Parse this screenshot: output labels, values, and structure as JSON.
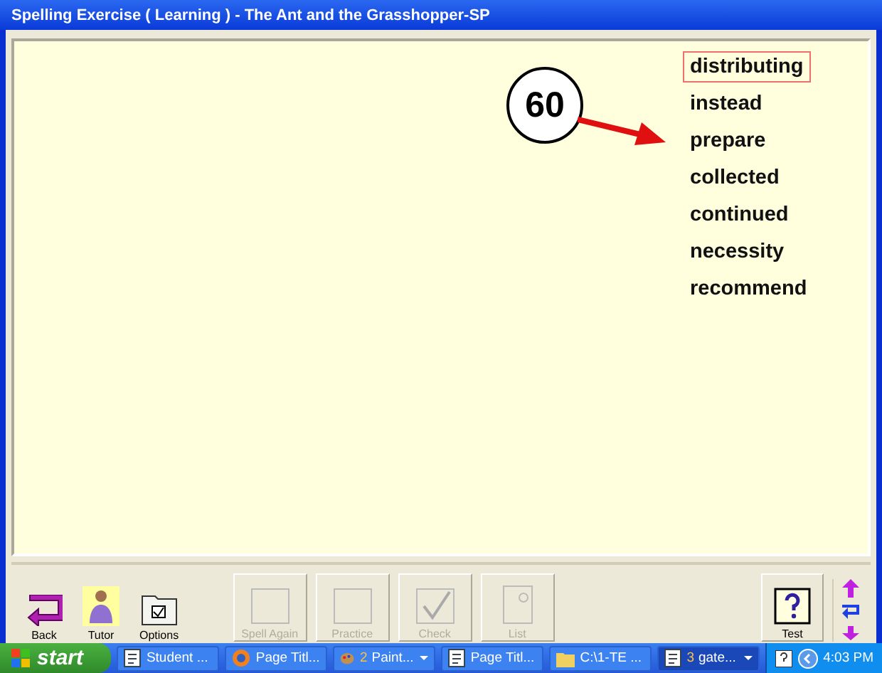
{
  "window": {
    "title": "Spelling Exercise ( Learning ) - The Ant and the Grasshopper-SP"
  },
  "words": [
    {
      "text": "distributing",
      "selected": true
    },
    {
      "text": "instead",
      "selected": false
    },
    {
      "text": "prepare",
      "selected": false
    },
    {
      "text": "collected",
      "selected": false
    },
    {
      "text": "continued",
      "selected": false
    },
    {
      "text": "necessity",
      "selected": false
    },
    {
      "text": "recommend",
      "selected": false
    }
  ],
  "callout": {
    "label": "60"
  },
  "toolbar": {
    "left": [
      {
        "label": "Back",
        "kind": "back",
        "disabled": false
      },
      {
        "label": "Tutor",
        "kind": "tutor",
        "disabled": false
      },
      {
        "label": "Options",
        "kind": "options",
        "disabled": false
      }
    ],
    "middle": [
      {
        "label": "Spell Again",
        "kind": "spell",
        "disabled": true
      },
      {
        "label": "Practice",
        "kind": "practice",
        "disabled": true
      },
      {
        "label": "Check",
        "kind": "check",
        "disabled": true
      },
      {
        "label": "List",
        "kind": "list",
        "disabled": true
      }
    ],
    "right": [
      {
        "label": "Test",
        "kind": "test",
        "disabled": false
      }
    ]
  },
  "taskbar": {
    "start": "start",
    "tasks": [
      {
        "label": "Student ...",
        "kind": "doc",
        "active": false,
        "group": false
      },
      {
        "label": "Page Titl...",
        "kind": "browser",
        "active": false,
        "group": false
      },
      {
        "count": "2",
        "label": "Paint...",
        "kind": "paint",
        "active": false,
        "group": true
      },
      {
        "label": "Page Titl...",
        "kind": "page",
        "active": false,
        "group": false
      },
      {
        "label": "C:\\1-TE ...",
        "kind": "folder",
        "active": false,
        "group": false
      },
      {
        "count": "3",
        "label": "gate...",
        "kind": "doc",
        "active": true,
        "group": true
      }
    ],
    "clock": "4:03 PM"
  }
}
